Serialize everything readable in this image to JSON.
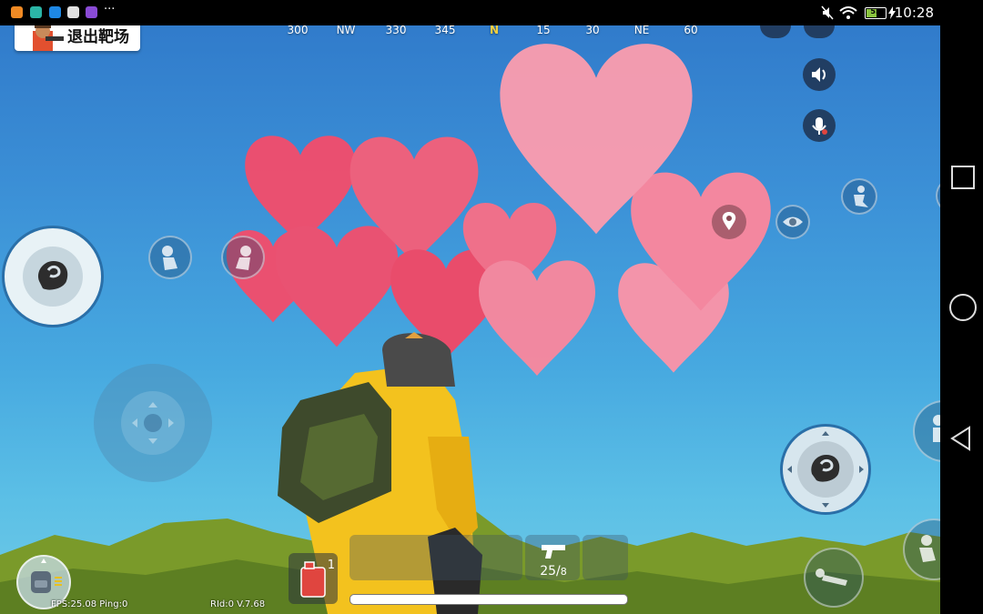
{
  "status_bar": {
    "time": "10:28",
    "battery": "55",
    "battery_level_percent": 55,
    "app_icons": [
      "taobao-icon",
      "app-icon",
      "trip-icon",
      "video-icon",
      "gallery-icon"
    ],
    "more": "···"
  },
  "exit_button": {
    "label": "退出靶场"
  },
  "compass": {
    "ticks": [
      "300",
      "NW",
      "330",
      "345",
      "N",
      "15",
      "30",
      "NE",
      "60"
    ],
    "highlight": "N"
  },
  "hud": {
    "fuel_count": "1",
    "ammo_current": "25/",
    "ammo_total": "8",
    "fps": "FPS:25.08 Ping:0",
    "version": "RId:0 V.7.68"
  },
  "colors": {
    "sky_top": "#2f78c9",
    "sky_bottom": "#6fc9e6",
    "heart_pink": "#f58ea6",
    "heart_red": "#f0506f",
    "character_yellow": "#f3c21e",
    "fuel_red": "#e0453f",
    "compass_north": "#f4d03f"
  },
  "icons": {
    "emote": "balloon-emote-icon",
    "speaker": "speaker-icon",
    "mic": "mic-muted-icon",
    "map_pin": "map-pin-icon",
    "eye": "eye-icon",
    "crouch": "crouch-icon",
    "jump": "jump-icon",
    "prone": "prone-icon",
    "backpack": "backpack-icon",
    "pistol": "pistol-icon",
    "fuel_can": "fuel-can-icon"
  }
}
